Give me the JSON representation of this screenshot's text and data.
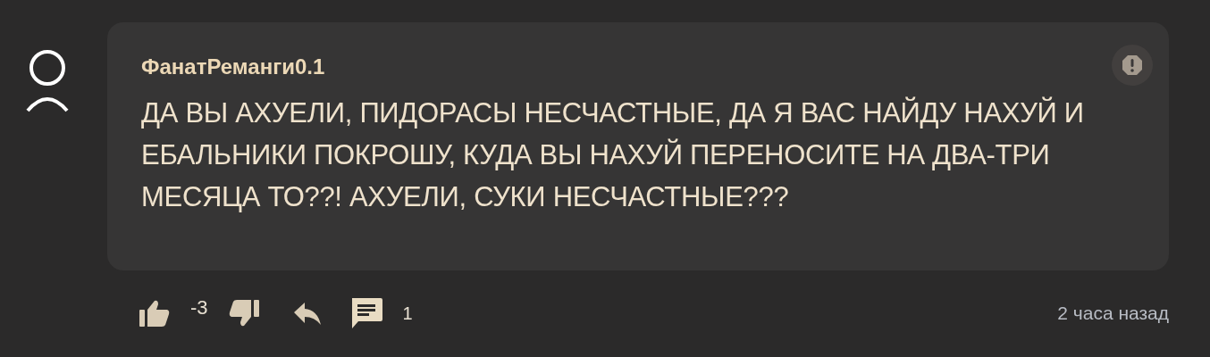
{
  "comment": {
    "author": "ФанатРеманги0.1",
    "text": "ДА ВЫ АХУЕЛИ, ПИДОРАСЫ НЕСЧАСТНЫЕ, ДА Я ВАС НАЙДУ НАХУЙ И ЕБАЛЬНИКИ ПОКРОШУ, КУДА ВЫ НАХУЙ ПЕРЕНОСИТЕ НА ДВА-ТРИ МЕСЯЦА ТО??! АХУЕЛИ, СУКИ НЕСЧАСТНЫЕ???",
    "score": "-3",
    "replies_count": "1",
    "time": "2 часа назад"
  }
}
